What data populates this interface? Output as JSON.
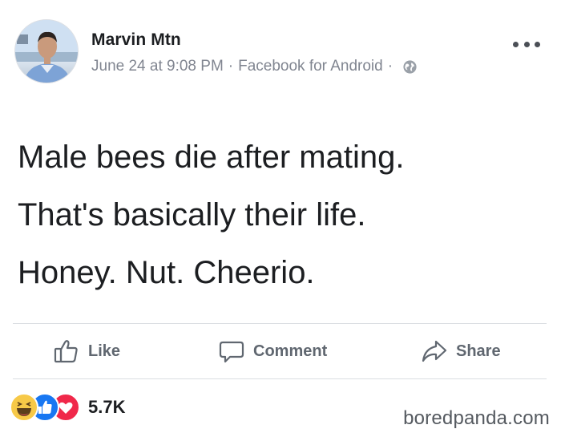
{
  "author": {
    "name": "Marvin Mtn",
    "date": "June 24 at 9:08 PM",
    "separator": "·",
    "source": "Facebook for Android",
    "audience_icon": "globe-icon"
  },
  "post": {
    "lines": [
      "Male bees die after mating.",
      "That's basically their life.",
      "Honey. Nut. Cheerio."
    ]
  },
  "actions": {
    "like_label": "Like",
    "comment_label": "Comment",
    "share_label": "Share"
  },
  "reactions": {
    "types": [
      "haha",
      "like",
      "love"
    ],
    "count": "5.7K"
  },
  "watermark": "boredpanda.com",
  "colors": {
    "like_blue": "#1877f2",
    "love_red": "#f0284a",
    "haha_yellow": "#f7c948",
    "secondary_text": "#808590"
  }
}
